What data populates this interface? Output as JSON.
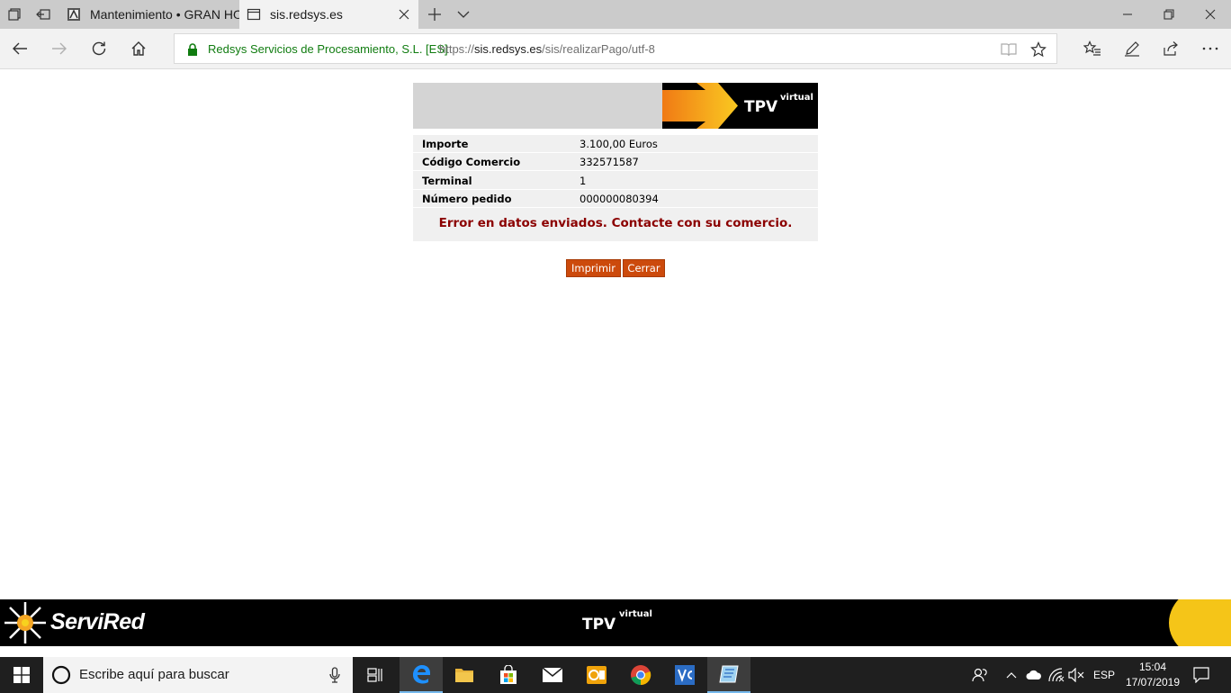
{
  "browser": {
    "tabs": [
      {
        "title": "Mantenimiento • GRAN HO",
        "active": false
      },
      {
        "title": "sis.redsys.es",
        "active": true
      }
    ],
    "address": {
      "cert_owner": "Redsys Servicios de Procesamiento, S.L. [ES]",
      "url_prefix": "https://",
      "url_host": "sis.redsys.es",
      "url_path": "/sis/realizarPago/utf-8"
    }
  },
  "payment": {
    "logo_text": "TPV",
    "logo_sup": "virtual",
    "rows": [
      {
        "label": "Importe",
        "value": "3.100,00  Euros"
      },
      {
        "label": "Código Comercio",
        "value": "332571587"
      },
      {
        "label": "Terminal",
        "value": "1"
      },
      {
        "label": "Número pedido",
        "value": "000000080394"
      }
    ],
    "error": "Error en datos enviados. Contacte con su comercio.",
    "buttons": {
      "print": "Imprimir",
      "close": "Cerrar"
    }
  },
  "footer": {
    "brand": "ServiRed",
    "tpv": "TPV",
    "tpv_sup": "virtual"
  },
  "taskbar": {
    "search_placeholder": "Escribe aquí para buscar",
    "language": "ESP",
    "time": "15:04",
    "date": "17/07/2019"
  },
  "colors": {
    "accent_button": "#cc4a0c",
    "error_text": "#8b0000",
    "secure_green": "#107c10",
    "footer_yellow": "#f5c518"
  }
}
